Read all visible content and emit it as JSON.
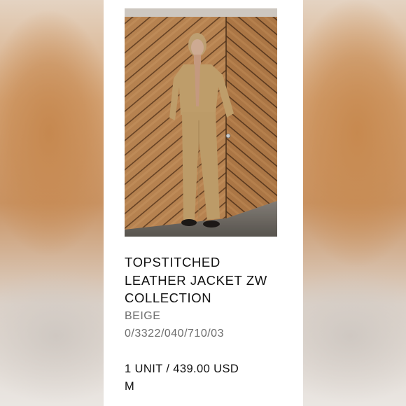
{
  "product": {
    "title_lines": [
      "TOPSTITCHED",
      "LEATHER JACKET ZW",
      "COLLECTION"
    ],
    "color": "BEIGE",
    "reference": "0/3322/040/710/03",
    "price_line": "1 UNIT / 439.00 USD",
    "size": "M"
  },
  "colors": {
    "background_blur": "#d9b89a",
    "card": "#ffffff",
    "text_primary": "#111111",
    "text_secondary": "#6e6e6e"
  }
}
